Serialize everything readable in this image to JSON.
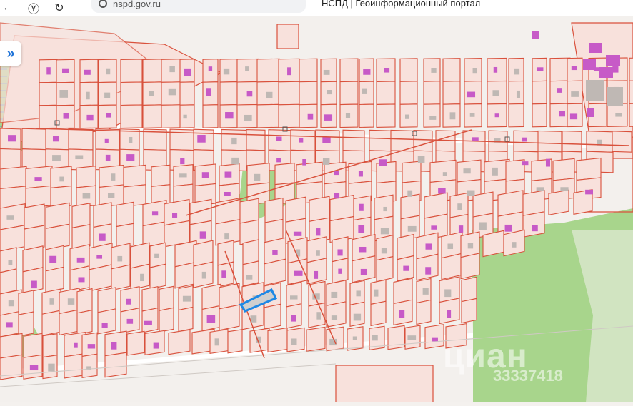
{
  "browser": {
    "url": "nspd.gov.ru",
    "title": "НСПД | Геоинформационный портал"
  },
  "map": {
    "parcel_fill": "#f8e1dc",
    "parcel_stroke": "#d9513c",
    "building_purple": "#c75ac7",
    "building_gray": "#bfb8b4",
    "vegetation": "#a8d58c",
    "water_pattern": "#5a93d6",
    "highlight": "#1e88e5"
  },
  "sidebar_toggle": {
    "icon": "double-chevron-right-icon"
  },
  "watermark": {
    "text": "циан",
    "id_text": "33337418"
  }
}
